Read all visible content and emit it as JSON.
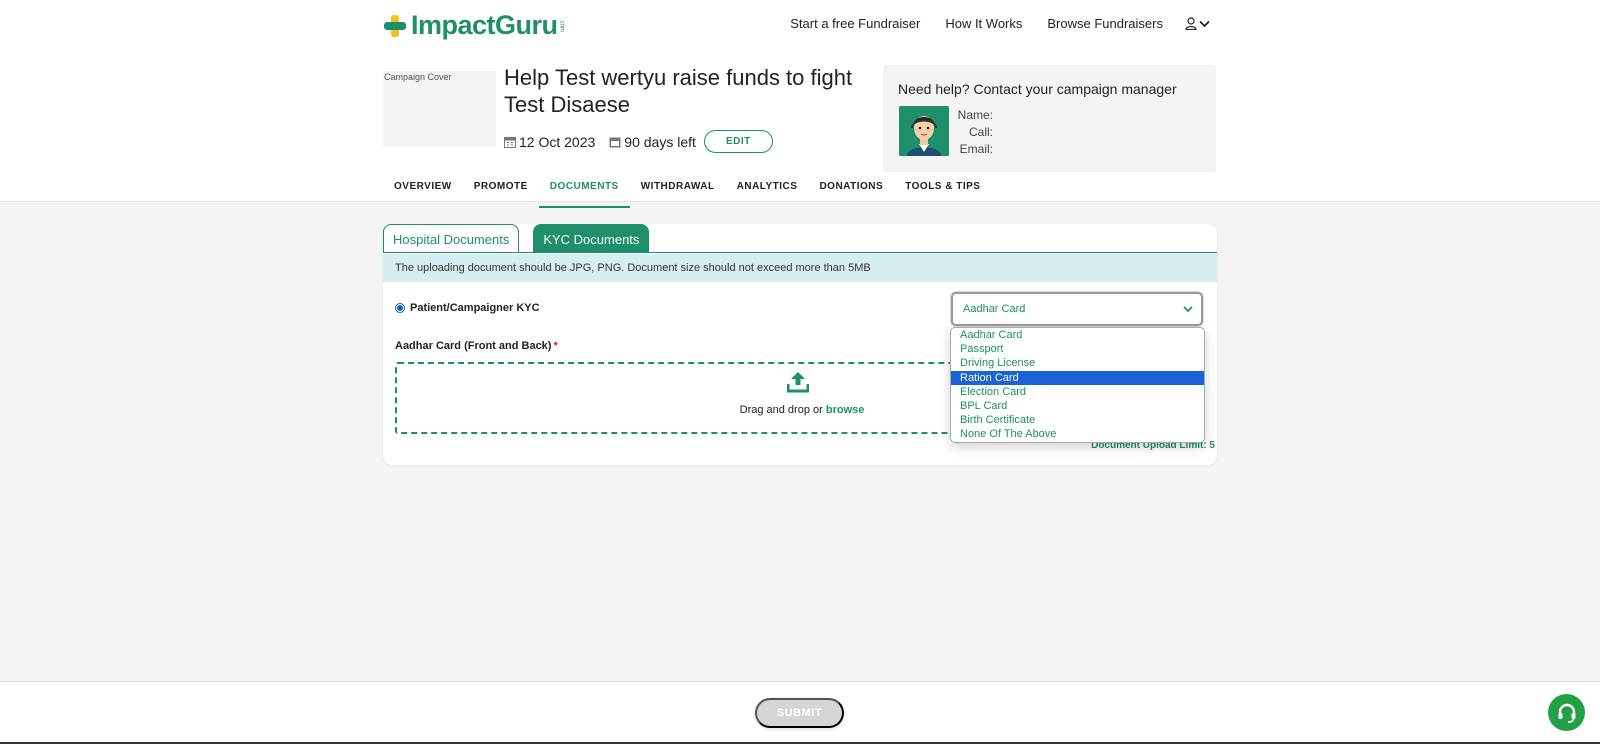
{
  "brand": {
    "name": "ImpactGuru",
    "suffix": ".com"
  },
  "topnav": {
    "links": [
      "Start a free Fundraiser",
      "How It Works",
      "Browse Fundraisers"
    ]
  },
  "campaign": {
    "cover_alt": "Campaign Cover",
    "title": "Help Test wertyu raise funds to fight Test Disaese",
    "date": "12 Oct 2023",
    "days_left": "90 days left",
    "edit_label": "EDIT"
  },
  "help": {
    "title": "Need help? Contact your campaign manager",
    "name_label": "Name:",
    "call_label": "Call:",
    "email_label": "Email:"
  },
  "tabs": [
    "OVERVIEW",
    "PROMOTE",
    "DOCUMENTS",
    "WITHDRAWAL",
    "ANALYTICS",
    "DONATIONS",
    "TOOLS & TIPS"
  ],
  "doc_tabs": {
    "hospital": "Hospital Documents",
    "kyc": "KYC Documents"
  },
  "notice": "The uploading document should be JPG, PNG. Document size should not exceed more than 5MB",
  "kyc": {
    "radio_label": "Patient/Campaigner KYC",
    "select_value": "Aadhar Card",
    "field_label": "Aadhar Card (Front and Back)",
    "required_mark": "*",
    "dz_text": "Drag and drop or ",
    "dz_browse": "browse",
    "limit": "Document Upload Limit: 5",
    "options": [
      "Aadhar Card",
      "Passport",
      "Driving License",
      "Ration Card",
      "Election Card",
      "BPL Card",
      "Birth Certificate",
      "None Of The Above"
    ],
    "highlighted_option": "Ration Card"
  },
  "footer": {
    "submit_label": "SUBMIT"
  },
  "colors": {
    "brand_green": "#1e8f6a",
    "logo_yellow": "#f2c318",
    "notice_bg": "#d6eeef",
    "highlight": "#1a63d6",
    "support_green": "#21a046"
  }
}
